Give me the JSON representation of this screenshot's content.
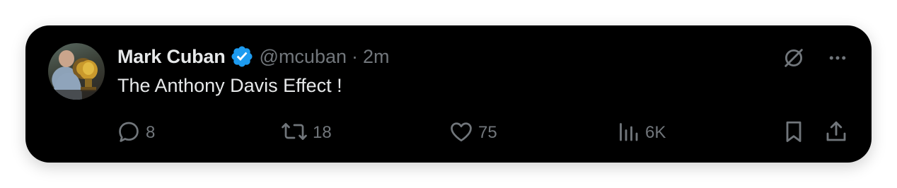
{
  "author": {
    "display_name": "Mark Cuban",
    "handle": "@mcuban",
    "separator": "·",
    "time": "2m",
    "verified_color": "#1d9bf0"
  },
  "tweet": {
    "text": "The Anthony Davis Effect !"
  },
  "top_actions": [
    "grok-icon",
    "more-icon"
  ],
  "actions": {
    "reply_count": "8",
    "retweet_count": "18",
    "like_count": "75",
    "views_count": "6K"
  },
  "colors": {
    "background": "#000000",
    "primary_text": "#e7e9ea",
    "secondary_text": "#71767b",
    "accent": "#1d9bf0"
  }
}
